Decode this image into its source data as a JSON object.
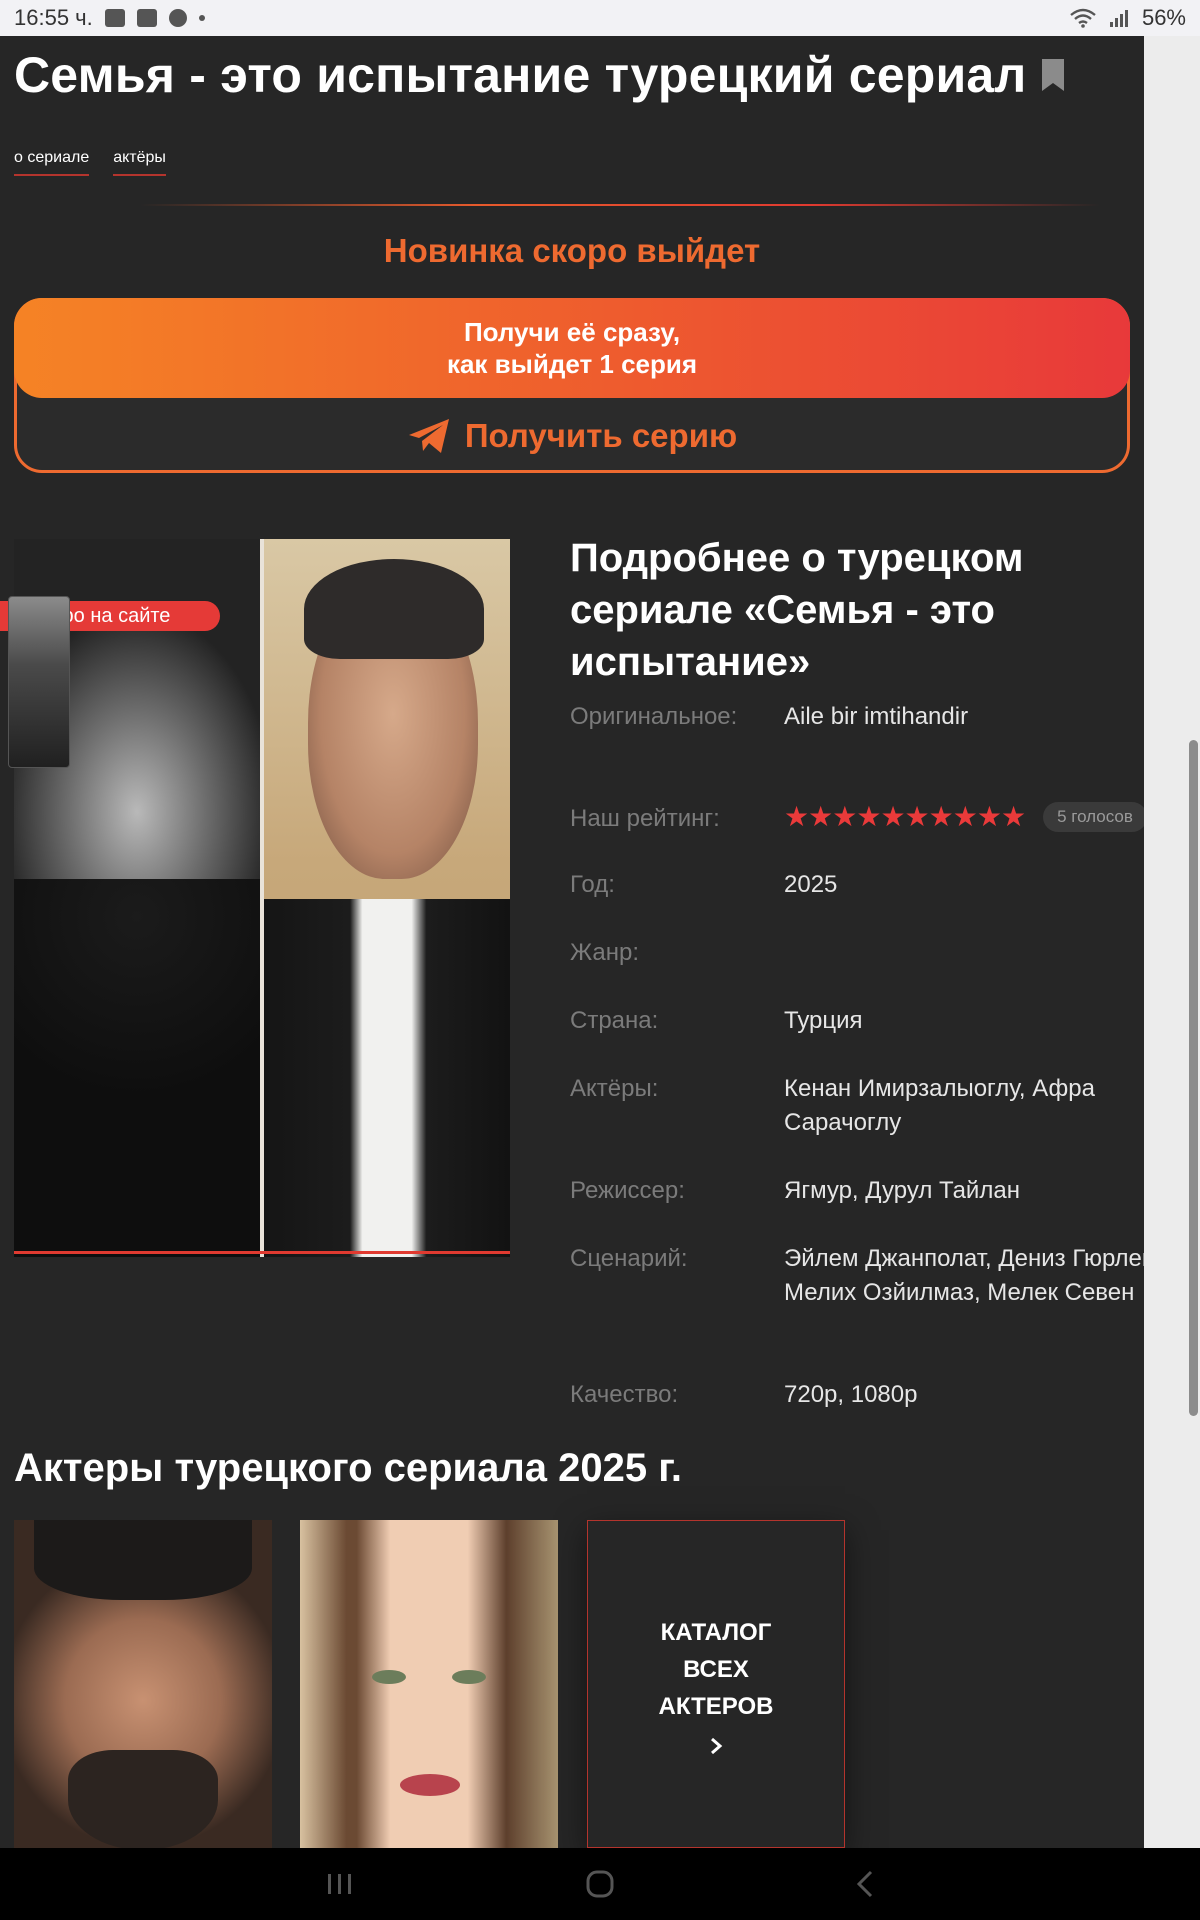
{
  "status_bar": {
    "time": "16:55 ч.",
    "battery": "56%",
    "icons": [
      "gallery-icon",
      "facebook-icon",
      "chrome-icon",
      "dot-icon",
      "wifi-icon",
      "signal-icon"
    ]
  },
  "page": {
    "title": "Семья - это испытание турецкий сериал",
    "tabs": [
      {
        "label": "о сериале"
      },
      {
        "label": "актёры"
      }
    ]
  },
  "promo": {
    "title": "Новинка скоро выйдет",
    "banner_line1": "Получи её сразу,",
    "banner_line2": "как выйдет 1 серия",
    "button_label": "Получить серию"
  },
  "poster": {
    "badge": "Скоро на сайте"
  },
  "details": {
    "heading": "Подробнее о турецком сериале «Семья - это испытание»",
    "original": {
      "label": "Оригинальное:",
      "value": "Aile bir imtihandir"
    },
    "rating": {
      "label": "Наш рейтинг:",
      "stars": 10,
      "votes": "5 голосов"
    },
    "year": {
      "label": "Год:",
      "value": "2025"
    },
    "genre": {
      "label": "Жанр:",
      "value": ""
    },
    "country": {
      "label": "Страна:",
      "value": "Турция"
    },
    "actors": {
      "label": "Актёры:",
      "value": "Кенан Имирзалыоглу, Афра Сарачоглу"
    },
    "director": {
      "label": "Режиссер:",
      "value": "Ягмур, Дурул Тайлан"
    },
    "screenplay": {
      "label": "Сценарий:",
      "value": "Эйлем Джанполат, Дениз Гюрлек, Мелих Озйилмаз, Мелек Севен"
    },
    "quality": {
      "label": "Качество:",
      "value": "720p, 1080p"
    }
  },
  "actors_section": {
    "title": "Актеры турецкого сериала 2025 г.",
    "catalog_line1": "КАТАЛОГ",
    "catalog_line2": "ВСЕХ",
    "catalog_line3": "АКТЕРОВ"
  },
  "colors": {
    "accent": "#ee6a30",
    "accent_red": "#e53a37",
    "background": "#262626"
  }
}
